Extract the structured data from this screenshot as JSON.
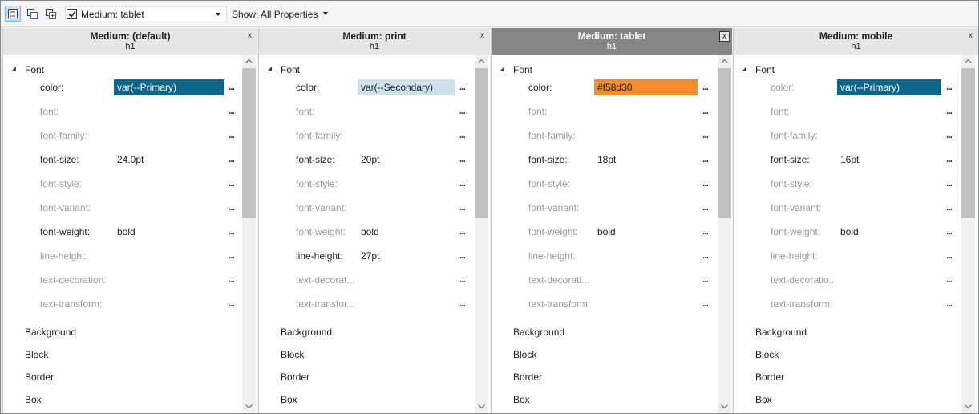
{
  "toolbar": {
    "medium_checked": true,
    "medium_select": "Medium: tablet",
    "show_select": "Show: All Properties"
  },
  "panels": [
    {
      "title": "Medium: (default)",
      "subtitle": "h1",
      "close": "x",
      "active": false,
      "font_category": "Font",
      "props": [
        {
          "name": "color:",
          "value": "var(--Primary)",
          "set": true,
          "bg": "#0e6588",
          "fg": "#ffffff"
        },
        {
          "name": "font:",
          "value": "",
          "set": false
        },
        {
          "name": "font-family:",
          "value": "",
          "set": false
        },
        {
          "name": "font-size:",
          "value": "24.0pt",
          "set": true
        },
        {
          "name": "font-style:",
          "value": "",
          "set": false
        },
        {
          "name": "font-variant:",
          "value": "",
          "set": false
        },
        {
          "name": "font-weight:",
          "value": "bold",
          "set": true
        },
        {
          "name": "line-height:",
          "value": "",
          "set": false
        },
        {
          "name": "text-decoration:",
          "value": "",
          "set": false
        },
        {
          "name": "text-transform:",
          "value": "",
          "set": false
        }
      ],
      "categories": [
        "Background",
        "Block",
        "Border",
        "Box"
      ]
    },
    {
      "title": "Medium: print",
      "subtitle": "h1",
      "close": "x",
      "active": false,
      "font_category": "Font",
      "props": [
        {
          "name": "color:",
          "value": "var(--Secondary)",
          "set": true,
          "bg": "#cde2ea",
          "fg": "#1e1e1e"
        },
        {
          "name": "font:",
          "value": "",
          "set": false
        },
        {
          "name": "font-family:",
          "value": "",
          "set": false
        },
        {
          "name": "font-size:",
          "value": "20pt",
          "set": true
        },
        {
          "name": "font-style:",
          "value": "",
          "set": false
        },
        {
          "name": "font-variant:",
          "value": "",
          "set": false
        },
        {
          "name": "font-weight:",
          "value": "bold",
          "set": false
        },
        {
          "name": "line-height:",
          "value": "27pt",
          "set": true
        },
        {
          "name": "text-decorat...",
          "value": "",
          "set": false
        },
        {
          "name": "text-transfor...",
          "value": "",
          "set": false
        }
      ],
      "categories": [
        "Background",
        "Block",
        "Border",
        "Box"
      ]
    },
    {
      "title": "Medium: tablet",
      "subtitle": "h1",
      "close": "x",
      "active": true,
      "font_category": "Font",
      "props": [
        {
          "name": "color:",
          "value": "#f58d30",
          "set": true,
          "bg": "#f58d30",
          "fg": "#1e1e1e"
        },
        {
          "name": "font:",
          "value": "",
          "set": false
        },
        {
          "name": "font-family:",
          "value": "",
          "set": false
        },
        {
          "name": "font-size:",
          "value": "18pt",
          "set": true
        },
        {
          "name": "font-style:",
          "value": "",
          "set": false
        },
        {
          "name": "font-variant:",
          "value": "",
          "set": false
        },
        {
          "name": "font-weight:",
          "value": "bold",
          "set": false
        },
        {
          "name": "line-height:",
          "value": "",
          "set": false
        },
        {
          "name": "text-decorati...",
          "value": "",
          "set": false
        },
        {
          "name": "text-transform:",
          "value": "",
          "set": false
        }
      ],
      "categories": [
        "Background",
        "Block",
        "Border",
        "Box"
      ]
    },
    {
      "title": "Medium: mobile",
      "subtitle": "h1",
      "close": "x",
      "active": false,
      "font_category": "Font",
      "props": [
        {
          "name": "color:",
          "value": "var(--Primary)",
          "set": false,
          "bg": "#0e6588",
          "fg": "#ffffff"
        },
        {
          "name": "font:",
          "value": "",
          "set": false
        },
        {
          "name": "font-family:",
          "value": "",
          "set": false
        },
        {
          "name": "font-size:",
          "value": "16pt",
          "set": true
        },
        {
          "name": "font-style:",
          "value": "",
          "set": false
        },
        {
          "name": "font-variant:",
          "value": "",
          "set": false
        },
        {
          "name": "font-weight:",
          "value": "bold",
          "set": false
        },
        {
          "name": "line-height:",
          "value": "",
          "set": false
        },
        {
          "name": "text-decoratio...",
          "value": "",
          "set": false
        },
        {
          "name": "text-transform:",
          "value": "",
          "set": false
        }
      ],
      "categories": [
        "Background",
        "Block",
        "Border",
        "Box"
      ]
    }
  ],
  "ellipsis": "..."
}
